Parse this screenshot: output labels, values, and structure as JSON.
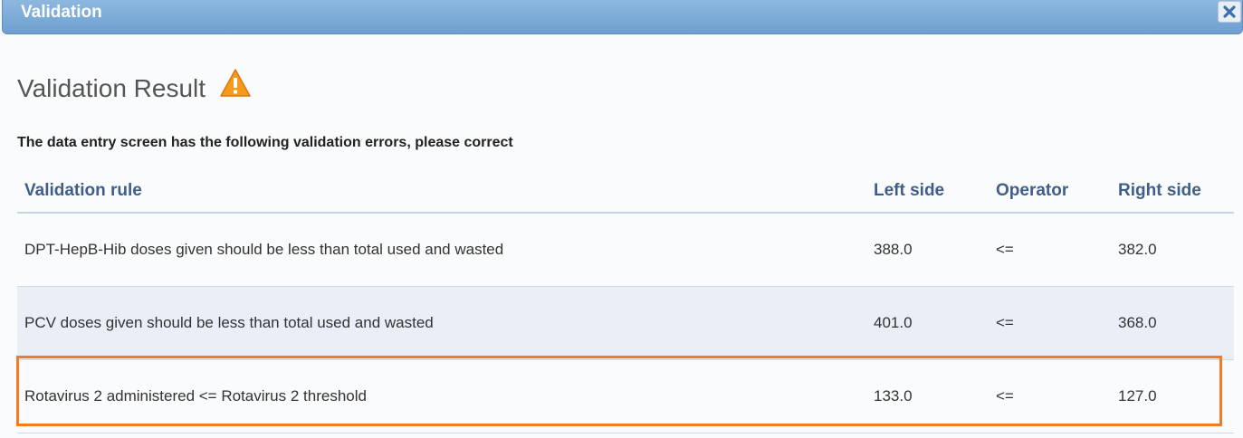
{
  "dialog": {
    "title": "Validation",
    "close_icon": "close-icon"
  },
  "heading": "Validation Result",
  "warning_icon": "warning-icon",
  "instructions": "The data entry screen has the following validation errors, please correct",
  "table": {
    "columns": [
      "Validation rule",
      "Left side",
      "Operator",
      "Right side"
    ],
    "rows": [
      {
        "rule": "DPT-HepB-Hib doses given should be less than total used and wasted",
        "left": "388.0",
        "operator": "<=",
        "right": "382.0"
      },
      {
        "rule": "PCV doses given should be less than total used and wasted",
        "left": "401.0",
        "operator": "<=",
        "right": "368.0"
      },
      {
        "rule": "Rotavirus 2 administered <= Rotavirus 2 threshold",
        "left": "133.0",
        "operator": "<=",
        "right": "127.0"
      }
    ]
  },
  "colors": {
    "titlebar": "#6d9fd0",
    "header_text": "#3f5f8a",
    "alt_row": "#e9eef7",
    "highlight": "#f47b20",
    "warning": "#f59a1b"
  }
}
